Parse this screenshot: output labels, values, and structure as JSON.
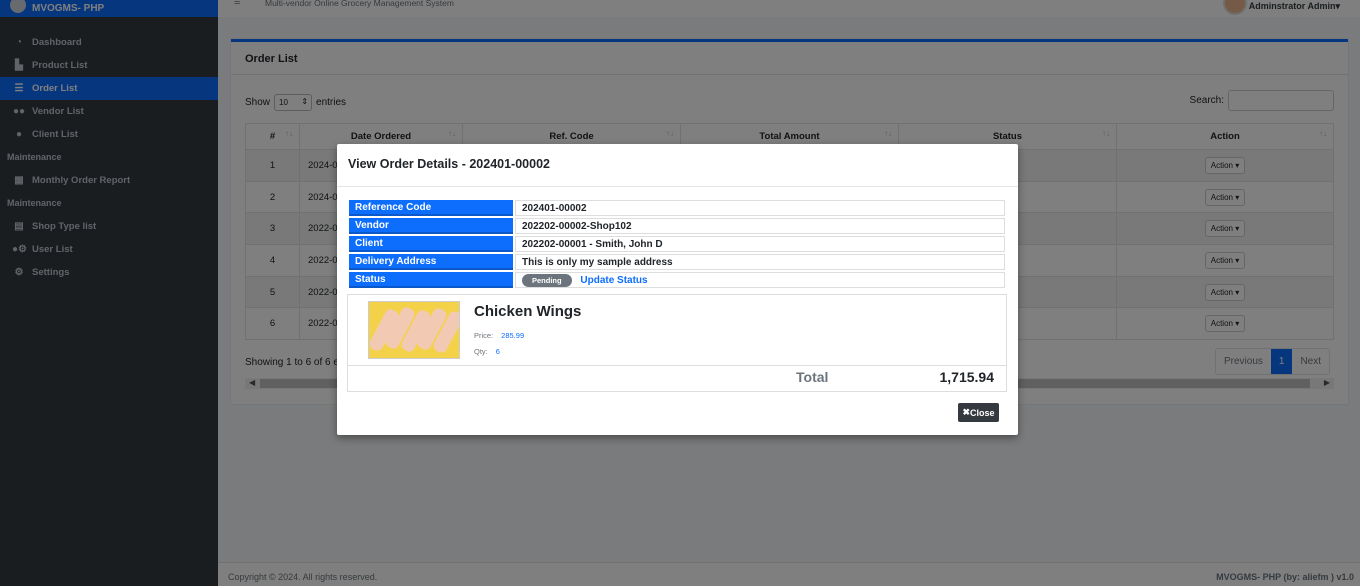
{
  "brand": "MVOGMS- PHP",
  "topbar": {
    "title": "Multi-vendor Online Grocery Management System",
    "user": "Adminstrator Admin"
  },
  "sidebar": {
    "items": [
      {
        "label": "Dashboard",
        "icon": "dashboard-icon"
      },
      {
        "label": "Product List",
        "icon": "product-icon"
      },
      {
        "label": "Order List",
        "icon": "list-icon"
      },
      {
        "label": "Vendor List",
        "icon": "users-icon"
      },
      {
        "label": "Client List",
        "icon": "user-icon"
      }
    ],
    "section1": "Maintenance",
    "report": "Monthly Order Report",
    "section2": "Maintenance",
    "items2": [
      {
        "label": "Shop Type list",
        "icon": "table-icon"
      },
      {
        "label": "User List",
        "icon": "users-cog-icon"
      },
      {
        "label": "Settings",
        "icon": "cogs-icon"
      }
    ]
  },
  "card": {
    "title": "Order List",
    "show_label": "Show",
    "entries_value": "10",
    "entries_label": "entries",
    "search_label": "Search:",
    "columns": [
      "#",
      "Date Ordered",
      "Ref. Code",
      "Total Amount",
      "Status",
      "Action"
    ],
    "rows": [
      {
        "n": "1",
        "date": "2024-0"
      },
      {
        "n": "2",
        "date": "2024-0"
      },
      {
        "n": "3",
        "date": "2022-0"
      },
      {
        "n": "4",
        "date": "2022-0"
      },
      {
        "n": "5",
        "date": "2022-0"
      },
      {
        "n": "6",
        "date": "2022-0"
      }
    ],
    "action_label": "Action",
    "showing": "Showing 1 to 6 of 6 e",
    "pager": {
      "prev": "Previous",
      "page": "1",
      "next": "Next"
    }
  },
  "footer": {
    "left": "Copyright © 2024. All rights reserved.",
    "right": "MVOGMS- PHP (by: aliefm ) v1.0"
  },
  "modal": {
    "title": "View Order Details - 202401-00002",
    "details": [
      {
        "key": "Reference Code",
        "value": "202401-00002"
      },
      {
        "key": "Vendor",
        "value": "202202-00002-Shop102"
      },
      {
        "key": "Client",
        "value": "202202-00001 - Smith, John D"
      },
      {
        "key": "Delivery Address",
        "value": "This is only my sample address"
      }
    ],
    "status_key": "Status",
    "status_badge": "Pending",
    "update_status": "Update Status",
    "item": {
      "name": "Chicken Wings",
      "price_label": "Price:",
      "price": "285.99",
      "qty_label": "Qty:",
      "qty": "6"
    },
    "total_label": "Total",
    "total": "1,715.94",
    "close": "Close"
  }
}
